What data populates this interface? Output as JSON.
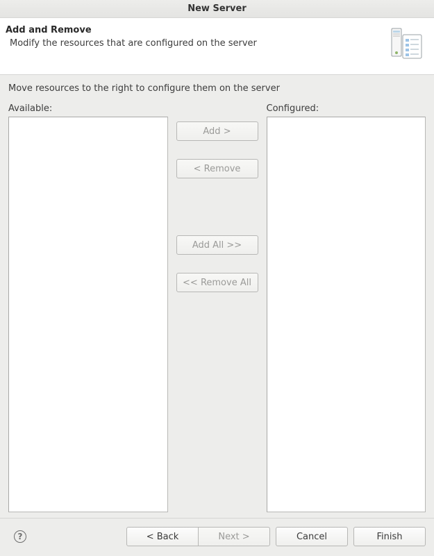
{
  "window": {
    "title": "New Server"
  },
  "banner": {
    "title": "Add and Remove",
    "description": "Modify the resources that are configured on the server"
  },
  "content": {
    "instruction": "Move resources to the right to configure them on the server",
    "available_label": "Available:",
    "configured_label": "Configured:",
    "available_items": [],
    "configured_items": []
  },
  "transfer_buttons": {
    "add": "Add >",
    "remove": "< Remove",
    "add_all": "Add All >>",
    "remove_all": "<< Remove All"
  },
  "footer": {
    "back": "< Back",
    "next": "Next >",
    "cancel": "Cancel",
    "finish": "Finish"
  },
  "state": {
    "add_enabled": false,
    "remove_enabled": false,
    "add_all_enabled": false,
    "remove_all_enabled": false,
    "back_enabled": true,
    "next_enabled": false,
    "cancel_enabled": true,
    "finish_enabled": true
  }
}
